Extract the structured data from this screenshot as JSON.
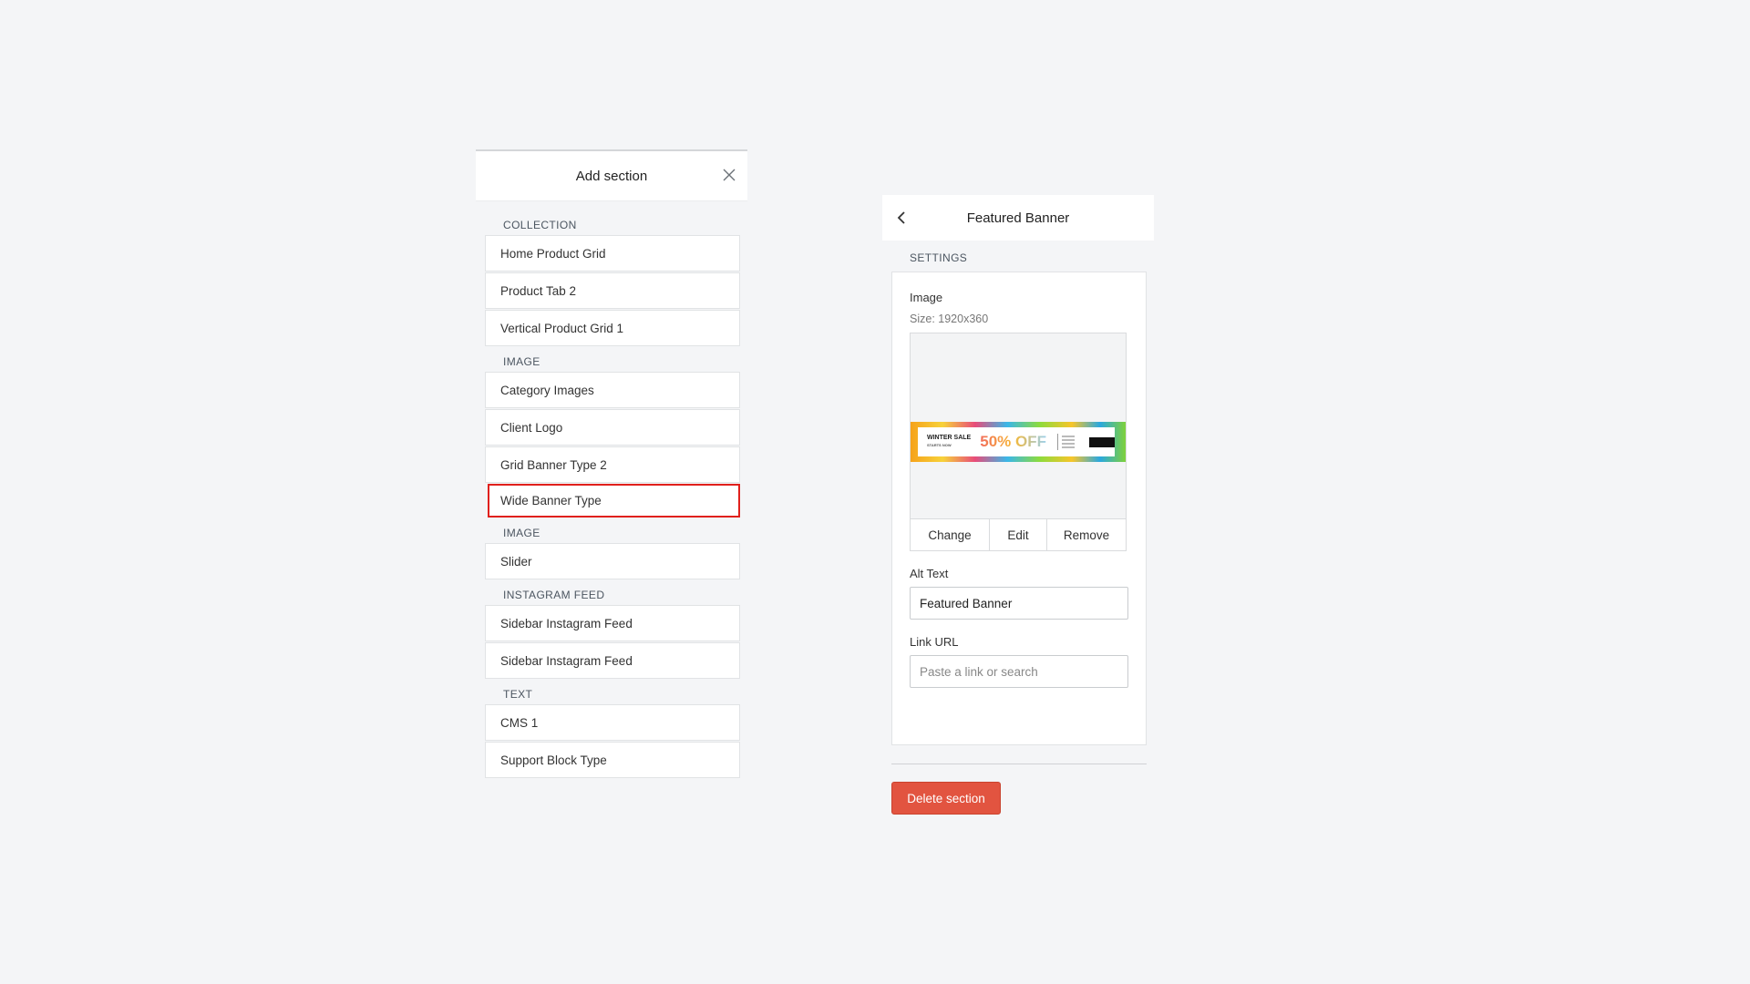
{
  "add_section": {
    "title": "Add section",
    "groups": [
      {
        "label": "COLLECTION",
        "items": [
          "Home Product Grid",
          "Product Tab 2",
          "Vertical Product Grid 1"
        ]
      },
      {
        "label": "IMAGE",
        "items": [
          "Category Images",
          "Client Logo",
          "Grid Banner Type 2",
          "Wide Banner Type"
        ]
      },
      {
        "label": "IMAGE",
        "items": [
          "Slider"
        ]
      },
      {
        "label": "INSTAGRAM FEED",
        "items": [
          "Sidebar Instagram Feed",
          "Sidebar Instagram Feed"
        ]
      },
      {
        "label": "TEXT",
        "items": [
          "CMS 1",
          "Support Block Type"
        ]
      }
    ],
    "highlighted_item": "Wide Banner Type"
  },
  "featured_banner": {
    "title": "Featured Banner",
    "settings_label": "SETTINGS",
    "image_label": "Image",
    "size_note": "Size: 1920x360",
    "banner_preview": {
      "headline": "WINTER SALE",
      "subline": "STARTS NOW",
      "offer": "50% OFF"
    },
    "image_actions": {
      "change": "Change",
      "edit": "Edit",
      "remove": "Remove"
    },
    "alt_text_label": "Alt Text",
    "alt_text_value": "Featured Banner",
    "link_url_label": "Link URL",
    "link_url_placeholder": "Paste a link or search",
    "delete_label": "Delete section"
  },
  "colors": {
    "background": "#f4f5f7",
    "highlight_border": "#e0201c",
    "delete_button": "#e25440"
  },
  "icons": {
    "close": "close-icon",
    "back": "chevron-left-icon"
  }
}
